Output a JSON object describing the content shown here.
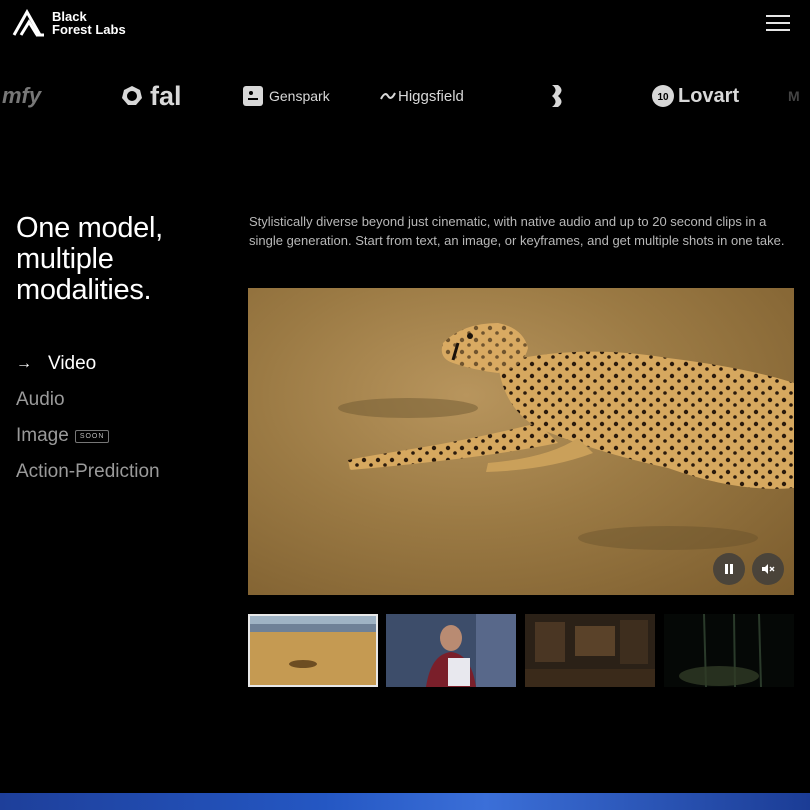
{
  "brand": {
    "line1": "Black",
    "line2": "Forest Labs"
  },
  "partners": [
    {
      "name": "mfy",
      "icon": ""
    },
    {
      "name": "fal",
      "icon": "fal-logo-icon"
    },
    {
      "name": "Genspark",
      "icon": "genspark-logo-icon"
    },
    {
      "name": "Higgsfield",
      "icon": "higgsfield-logo-icon"
    },
    {
      "name": "",
      "icon": "partner-mark-icon"
    },
    {
      "name": "Lovart",
      "icon": "lovart-logo-icon"
    }
  ],
  "hero": {
    "headline": "One model, multiple modalities.",
    "description": "Stylistically diverse beyond just cinematic, with native audio and up to 20 second clips in a single generation. Start from text, an image, or keyframes, and get multiple shots in one take."
  },
  "modalities": [
    {
      "label": "Video",
      "active": true,
      "badge": ""
    },
    {
      "label": "Audio",
      "active": false,
      "badge": ""
    },
    {
      "label": "Image",
      "active": false,
      "badge": "SOON"
    },
    {
      "label": "Action-Prediction",
      "active": false,
      "badge": ""
    }
  ],
  "player": {
    "pause_icon": "pause-icon",
    "mute_icon": "mute-icon"
  },
  "thumbnails": [
    {
      "subject": "cheetah-savanna",
      "active": true
    },
    {
      "subject": "news-reporter",
      "active": false
    },
    {
      "subject": "library-interior",
      "active": false
    },
    {
      "subject": "night-forest",
      "active": false
    }
  ],
  "colors": {
    "background": "#000000",
    "muted_text": "#9a9a9a",
    "accent_band": "#2457c3"
  }
}
